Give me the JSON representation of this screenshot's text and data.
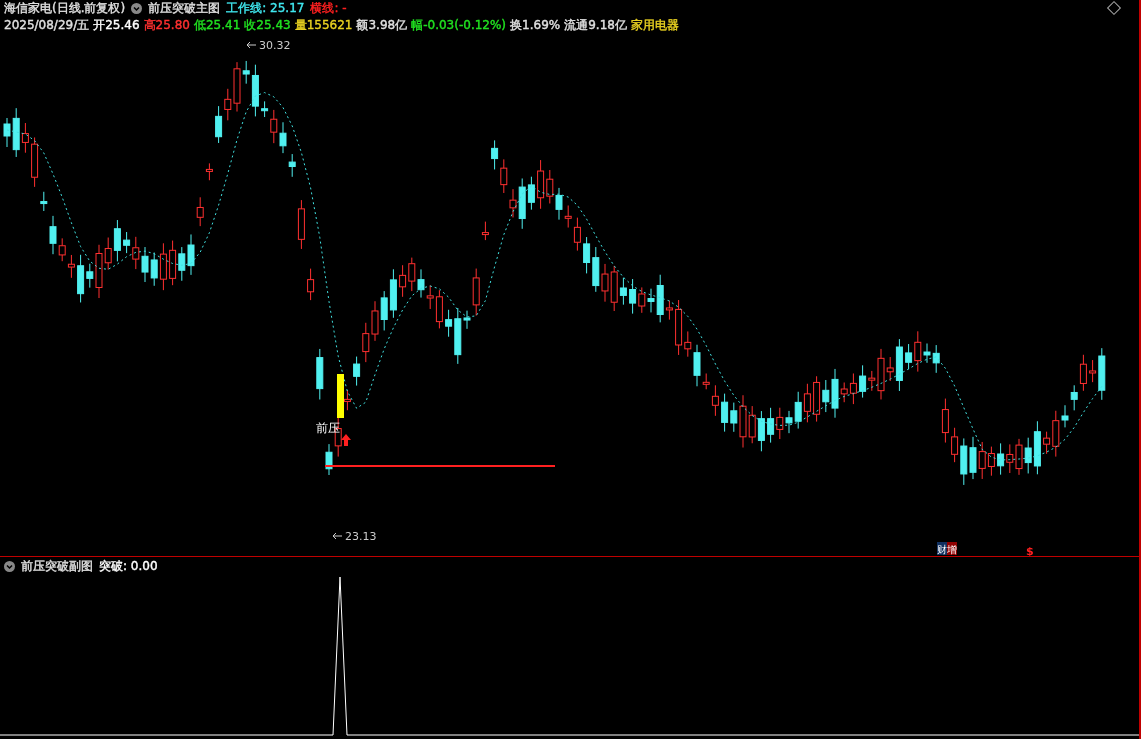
{
  "main_chart": {
    "title": "海信家电(日线.前复权)",
    "indicator_name": "前压突破主图",
    "indicators": [
      {
        "text": "工作线: 25.17",
        "color": "#40e8f0"
      },
      {
        "text": "横线: -",
        "color": "#ff2020"
      }
    ],
    "quote": [
      {
        "text": "2025/08/29/五",
        "color": "#e0e0e0"
      },
      {
        "text": "开25.46",
        "color": "#ffffff"
      },
      {
        "text": "高25.80",
        "color": "#ff3030"
      },
      {
        "text": "低25.41",
        "color": "#20e020"
      },
      {
        "text": "收25.43",
        "color": "#20e020"
      },
      {
        "text": "量155621",
        "color": "#e8d020"
      },
      {
        "text": "额3.98亿",
        "color": "#e0e0e0"
      },
      {
        "text": "幅-0.03(-0.12%)",
        "color": "#20e020"
      },
      {
        "text": "换1.69%",
        "color": "#e0e0e0"
      },
      {
        "text": "流通9.18亿",
        "color": "#e0e0e0"
      },
      {
        "text": "家用电器",
        "color": "#e8d020"
      }
    ],
    "high_label": "30.32",
    "low_label": "23.13",
    "signal_label": "前压",
    "markers": [
      {
        "text": "财",
        "color": "#103060"
      },
      {
        "text": "增",
        "color": "#900000"
      }
    ],
    "trade_marker": "$"
  },
  "sub_chart": {
    "title": "前压突破副图",
    "reading": "突破: 0.00"
  }
}
